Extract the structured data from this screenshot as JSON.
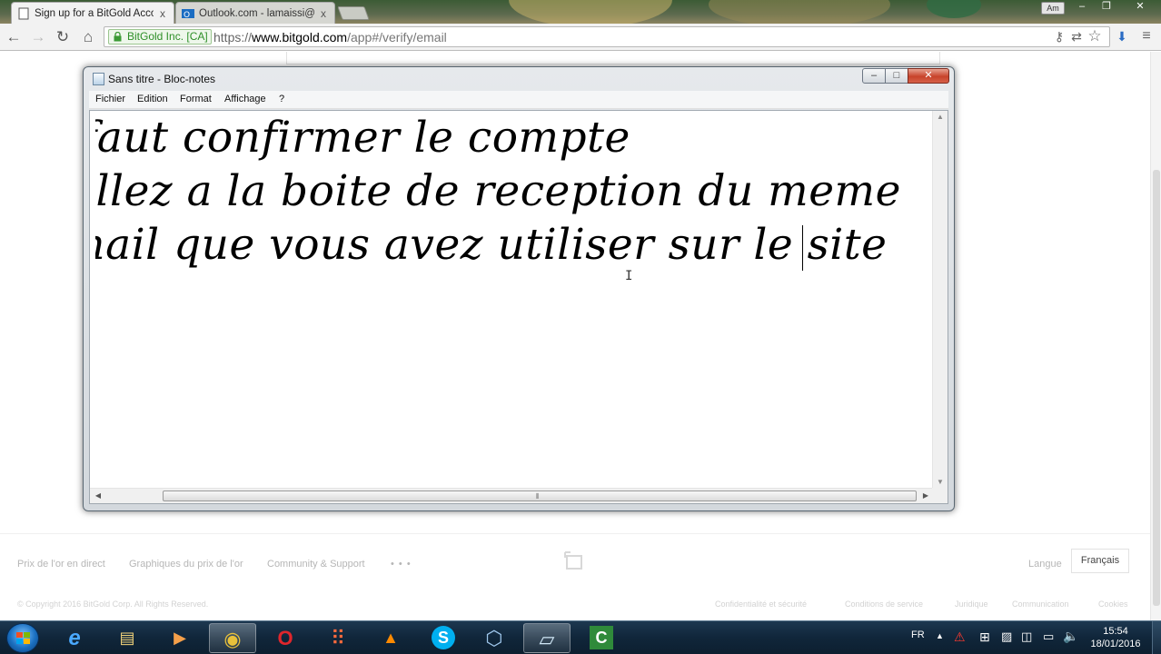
{
  "browser": {
    "tabs": [
      {
        "title": "Sign up for a BitGold Acco",
        "close": "x",
        "active": true
      },
      {
        "title": "Outlook.com - lamaissi@c",
        "close": "x",
        "active": false
      }
    ],
    "profile_label": "Am",
    "window_controls": {
      "minimize": "–",
      "restore": "❐",
      "close": "✕"
    },
    "nav": {
      "back": "←",
      "forward": "→",
      "reload": "↻",
      "home": "⌂"
    },
    "ev_badge": "BitGold Inc. [CA]",
    "url_scheme": "https://",
    "url_host": "www.bitgold.com",
    "url_path": "/app#/verify/email",
    "toolbar_icons": {
      "key": "⚷",
      "translate": "⇄",
      "star": "☆",
      "download": "⬇",
      "menu": "≡"
    }
  },
  "notepad": {
    "title": "Sans titre - Bloc-notes",
    "controls": {
      "minimize": "–",
      "maximize": "□",
      "close": "✕"
    },
    "menu": [
      "Fichier",
      "Edition",
      "Format",
      "Affichage",
      "?"
    ],
    "lines": [
      "faut confirmer le compte",
      "allez a la boite de reception du meme",
      "mail que vous avez utiliser sur le site"
    ],
    "scroll_up": "▲",
    "scroll_down": "▼",
    "scroll_left": "◀",
    "scroll_right": "▶",
    "grip": "⦀"
  },
  "page": {
    "footer_nav": [
      "Prix de l'or en direct",
      "Graphiques du prix de l'or",
      "Community & Support",
      "• • •"
    ],
    "language_label": "Langue",
    "language_value": "Français",
    "copyright": "© Copyright 2016 BitGold Corp. All Rights Reserved.",
    "footer_links": [
      "Confidentialité et sécurité",
      "Conditions de service",
      "Juridique",
      "Communication",
      "Cookies"
    ]
  },
  "taskbar": {
    "apps": [
      {
        "name": "internet-explorer",
        "glyph": "e"
      },
      {
        "name": "file-explorer",
        "glyph": "▤"
      },
      {
        "name": "media-player",
        "glyph": "▶"
      },
      {
        "name": "chrome",
        "glyph": "◉"
      },
      {
        "name": "opera",
        "glyph": "O"
      },
      {
        "name": "app-grid",
        "glyph": "⠿"
      },
      {
        "name": "vlc",
        "glyph": "▲"
      },
      {
        "name": "skype",
        "glyph": "S"
      },
      {
        "name": "virtualbox",
        "glyph": "⬡"
      },
      {
        "name": "notepad",
        "glyph": "▱"
      },
      {
        "name": "camtasia",
        "glyph": "C"
      }
    ],
    "language": "FR",
    "time": "15:54",
    "date": "18/01/2016"
  },
  "colors": {
    "ev_green": "#2e8f28",
    "taskbar": "#10263a",
    "close_red": "#c8432b"
  }
}
